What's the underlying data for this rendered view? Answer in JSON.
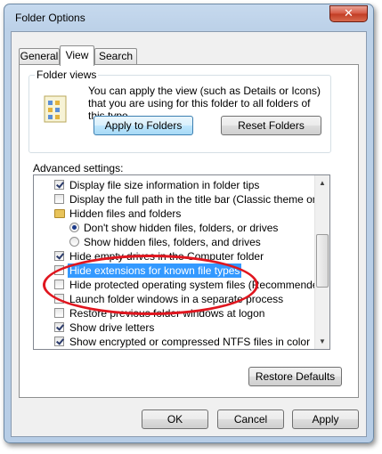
{
  "window": {
    "title": "Folder Options",
    "close_glyph": "✕"
  },
  "tabs": [
    {
      "label": "General",
      "active": false
    },
    {
      "label": "View",
      "active": true
    },
    {
      "label": "Search",
      "active": false
    }
  ],
  "folder_views": {
    "legend": "Folder views",
    "description": "You can apply the view (such as Details or Icons) that you are using for this folder to all folders of this type.",
    "apply_label": "Apply to Folders",
    "reset_label": "Reset Folders",
    "icon": "folder-views-icon"
  },
  "advanced": {
    "label": "Advanced settings:",
    "items": [
      {
        "type": "checkbox",
        "checked": true,
        "label": "Display file size information in folder tips"
      },
      {
        "type": "checkbox",
        "checked": false,
        "label": "Display the full path in the title bar (Classic theme only)"
      },
      {
        "type": "folder",
        "label": "Hidden files and folders"
      },
      {
        "type": "radio",
        "selected": true,
        "label": "Don't show hidden files, folders, or drives"
      },
      {
        "type": "radio",
        "selected": false,
        "label": "Show hidden files, folders, and drives"
      },
      {
        "type": "checkbox",
        "checked": true,
        "label": "Hide empty drives in the Computer folder"
      },
      {
        "type": "checkbox",
        "checked": false,
        "label": "Hide extensions for known file types",
        "highlighted": true
      },
      {
        "type": "checkbox",
        "checked": false,
        "label": "Hide protected operating system files (Recommended)"
      },
      {
        "type": "checkbox",
        "checked": false,
        "label": "Launch folder windows in a separate process"
      },
      {
        "type": "checkbox",
        "checked": false,
        "label": "Restore previous folder windows at logon"
      },
      {
        "type": "checkbox",
        "checked": true,
        "label": "Show drive letters"
      },
      {
        "type": "checkbox",
        "checked": true,
        "label": "Show encrypted or compressed NTFS files in color"
      }
    ]
  },
  "restore_defaults_label": "Restore Defaults",
  "footer": {
    "ok_label": "OK",
    "cancel_label": "Cancel",
    "apply_label": "Apply"
  },
  "colors": {
    "highlight": "#3399ff",
    "annotation": "#e0161f"
  }
}
